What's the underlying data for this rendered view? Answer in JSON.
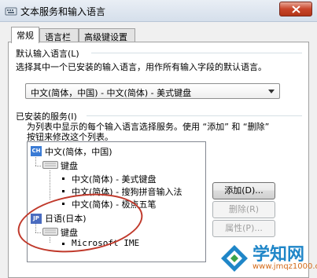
{
  "window": {
    "title": "文本服务和输入语言"
  },
  "tabs": [
    {
      "label": "常规",
      "active": true
    },
    {
      "label": "语言栏",
      "active": false
    },
    {
      "label": "高级键设置",
      "active": false
    }
  ],
  "default_language": {
    "group_label": "默认输入语言(L)",
    "description": "选择其中一个已安装的输入语言，用作所有输入字段的默认语言。",
    "selected": "中文(简体，中国) - 中文(简体) - 美式键盘"
  },
  "installed_services": {
    "group_label": "已安装的服务(I)",
    "description_line1": "为列表中显示的每个输入语言选择服务。使用 “添加” 和 “删除”",
    "description_line2": "按钮来修改这个列表。",
    "tree": {
      "chinese": {
        "icon_text": "CH",
        "label": "中文(简体，中国)",
        "keyboard_label": "键盘",
        "items": [
          "中文(简体) - 美式键盘",
          "中文(简体) - 搜狗拼音输入法",
          "中文(简体) - 极点五笔"
        ]
      },
      "japanese": {
        "icon_text": "JP",
        "label": "日语(日本)",
        "keyboard_label": "键盘",
        "items": [
          "Microsoft IME"
        ]
      }
    }
  },
  "buttons": {
    "add": "添加(D)...",
    "remove": "删除(R)",
    "properties": "属性(P)..."
  },
  "watermark": {
    "brand": "学知网",
    "url": "www.jmqz1000.com"
  },
  "colors": {
    "annotation_circle": "#c0392b",
    "brand_blue": "#1f86c8",
    "brand_orange": "#d46b1a"
  }
}
